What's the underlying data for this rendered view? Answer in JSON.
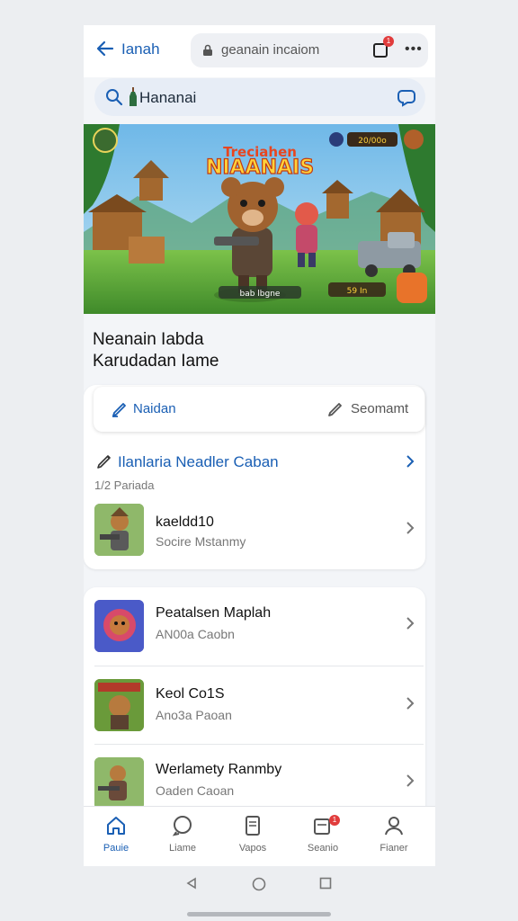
{
  "header": {
    "title": "Ianah",
    "url": "geanain incaiom",
    "tab_badge": "1"
  },
  "search": {
    "query": "Hananai"
  },
  "banner": {
    "logo_top": "Treciahen",
    "logo_main": "NIAANAIS",
    "score_chip": "20/00o",
    "bottom_chip": "bab lbgne",
    "coin_chip": "59 In"
  },
  "headline": {
    "line1": "Neanain Iabda",
    "line2": "Karudadan Iame"
  },
  "segment": {
    "left_label": "Naidan",
    "right_label": "Seomamt"
  },
  "section": {
    "title": "Ilanlaria Neadler Caban",
    "subtitle": "1/2 Pariada"
  },
  "featured_item": {
    "title": "kaeldd10",
    "subtitle": "Socire Mstanmy"
  },
  "list": [
    {
      "title": "Peatalsen Maplah",
      "subtitle": "AN00a Caobn"
    },
    {
      "title": "Keol Co1S",
      "subtitle": "Ano3a Paoan"
    },
    {
      "title": "Werlamety Ranmby",
      "subtitle": "Oaden Caoan"
    }
  ],
  "bottom_nav": [
    {
      "label": "Pauie",
      "icon": "home-icon",
      "active": true
    },
    {
      "label": "Liame",
      "icon": "chat-icon",
      "active": false
    },
    {
      "label": "Vapos",
      "icon": "document-icon",
      "active": false
    },
    {
      "label": "Seanio",
      "icon": "notification-icon",
      "active": false,
      "badge": "1"
    },
    {
      "label": "Fianer",
      "icon": "profile-icon",
      "active": false
    }
  ],
  "colors": {
    "accent": "#1a5fb4",
    "badge": "#e13c3c"
  }
}
